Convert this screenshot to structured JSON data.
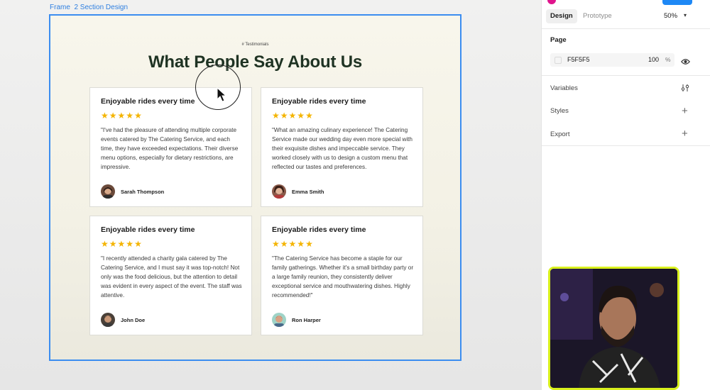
{
  "canvas": {
    "frame_label": "Frame  2 Section Design",
    "eyebrow": "# Testimonials",
    "heading": "What People Say About Us",
    "cards": [
      {
        "title": "Enjoyable rides every time",
        "rating": 5,
        "quote": "\"I've had the pleasure of attending multiple corporate events catered by The Catering Service, and each time, they have exceeded expectations. Their diverse menu options, especially for dietary restrictions, are impressive.",
        "author": "Sarah Thompson"
      },
      {
        "title": "Enjoyable rides every time",
        "rating": 5,
        "quote": "\"What an amazing culinary experience! The Catering Service made our wedding day even more special with their exquisite dishes and impeccable service. They worked closely with us to design a custom menu that reflected our tastes and preferences.",
        "author": "Emma Smith"
      },
      {
        "title": "Enjoyable rides every time",
        "rating": 5,
        "quote": "\"I recently attended a charity gala catered by The Catering Service, and I must say it was top-notch! Not only was the food delicious, but the attention to detail was evident in every aspect of the event. The staff was attentive.",
        "author": "John Doe"
      },
      {
        "title": "Enjoyable rides every time",
        "rating": 5,
        "quote": "\"The Catering Service has become a staple for our family gatherings. Whether it's a small birthday party or a large family reunion, they consistently deliver exceptional service and mouthwatering dishes. Highly recommended!\"",
        "author": "Ron Harper"
      }
    ]
  },
  "panel": {
    "tabs": [
      "Design",
      "Prototype"
    ],
    "active_tab": "Design",
    "zoom": "50%",
    "page_section": {
      "title": "Page",
      "fill_hex": "F5F5F5",
      "opacity": "100",
      "opacity_unit": "%"
    },
    "sections": [
      "Variables",
      "Styles",
      "Export"
    ]
  },
  "colors": {
    "selection": "#3b8df0",
    "star": "#f4b400",
    "heading": "#1f3323",
    "webcam_border": "#d9f01d"
  },
  "icons": [
    "cursor-arrow-icon",
    "star-icon",
    "eye-icon",
    "variables-icon",
    "plus-icon",
    "chevron-down-icon"
  ]
}
